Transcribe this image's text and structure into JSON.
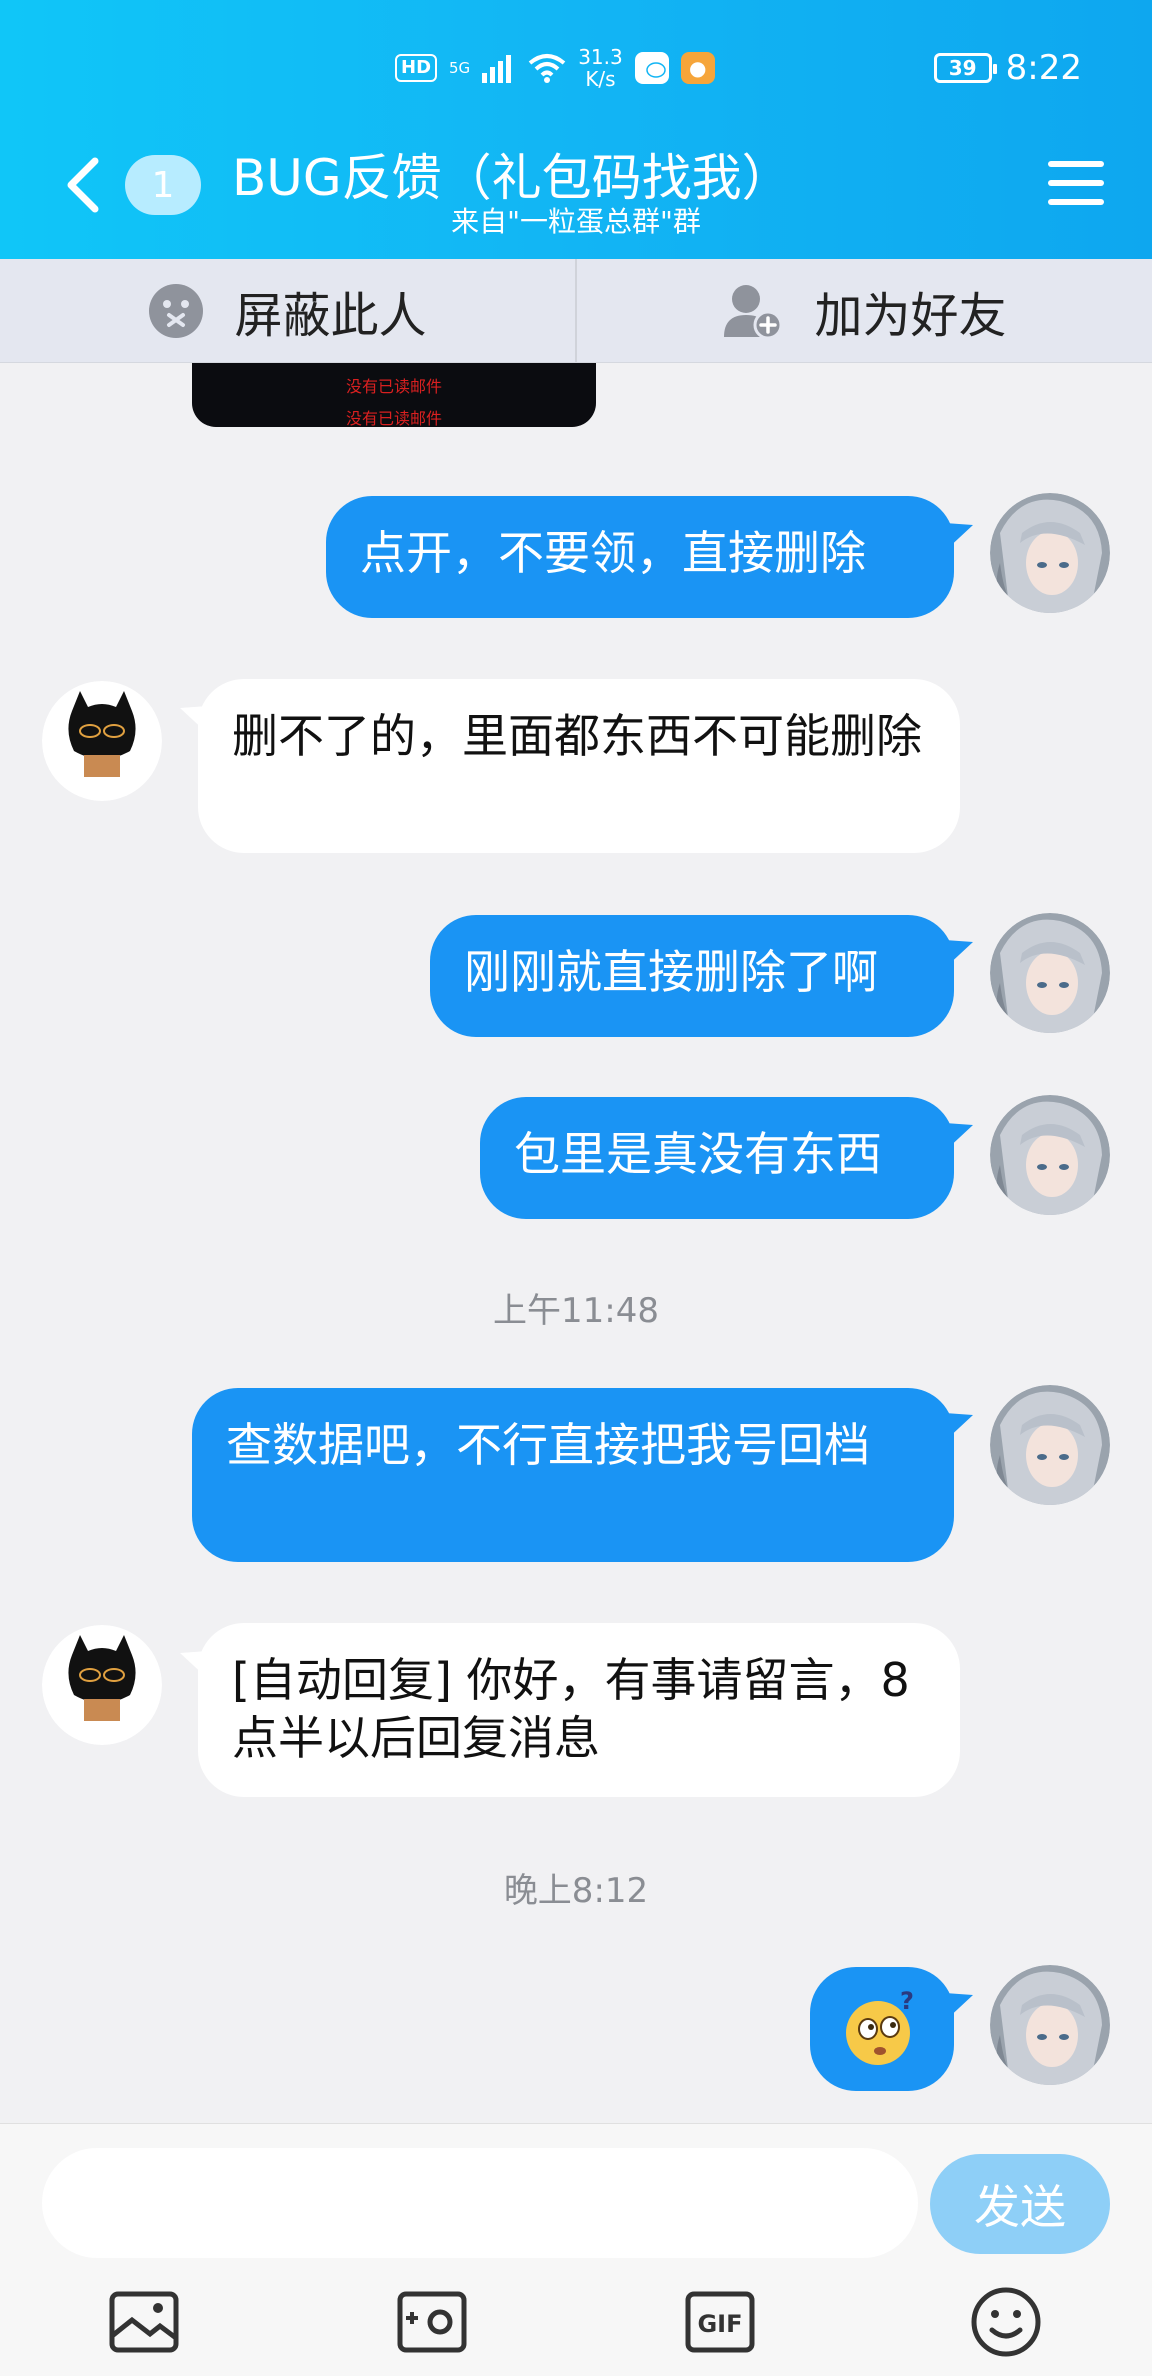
{
  "status_bar": {
    "hd": "HD",
    "network": "5G",
    "speed_value": "31.3",
    "speed_unit": "K/s",
    "battery": "39",
    "time": "8:22"
  },
  "header": {
    "unread_count": "1",
    "title": "BUG反馈（礼包码找我）",
    "subtitle": "来自\"一粒蛋总群\"群"
  },
  "actions": {
    "block_label": "屏蔽此人",
    "add_friend_label": "加为好友"
  },
  "image_preview": {
    "line1": "没有已读邮件",
    "line2": "没有已读邮件"
  },
  "messages": [
    {
      "direction": "out",
      "text": "点开，不要领，直接删除"
    },
    {
      "direction": "in",
      "text": "删不了的，里面都东西不可能删除"
    },
    {
      "direction": "out",
      "text": "刚刚就直接删除了啊"
    },
    {
      "direction": "out",
      "text": "包里是真没有东西"
    },
    {
      "direction": "out",
      "text": "查数据吧，不行直接把我号回档"
    },
    {
      "direction": "in",
      "text": "[自动回复] 你好，有事请留言，8点半以后回复消息"
    },
    {
      "direction": "out",
      "text": "🙄",
      "emoji": "thinking-face-emoji"
    }
  ],
  "timestamps": {
    "t1": "上午11:48",
    "t2": "晚上8:12"
  },
  "input": {
    "placeholder": "",
    "send_label": "发送"
  },
  "colors": {
    "header_blue": "#12b5f4",
    "bubble_out": "#1a94f4",
    "bubble_in": "#ffffff",
    "send_disabled": "#8ecff7"
  }
}
